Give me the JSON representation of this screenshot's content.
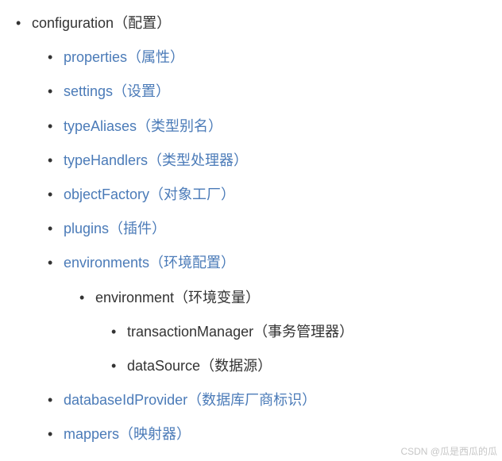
{
  "tree": {
    "root": {
      "label": "configuration（配置）",
      "children": [
        {
          "label": "properties（属性）",
          "link": true
        },
        {
          "label": "settings（设置）",
          "link": true
        },
        {
          "label": "typeAliases（类型别名）",
          "link": true
        },
        {
          "label": "typeHandlers（类型处理器）",
          "link": true
        },
        {
          "label": "objectFactory（对象工厂）",
          "link": true
        },
        {
          "label": "plugins（插件）",
          "link": true
        },
        {
          "label": "environments（环境配置）",
          "link": true,
          "children": [
            {
              "label": "environment（环境变量）",
              "link": false,
              "children": [
                {
                  "label": "transactionManager（事务管理器）",
                  "link": false
                },
                {
                  "label": "dataSource（数据源）",
                  "link": false
                }
              ]
            }
          ]
        },
        {
          "label": "databaseIdProvider（数据库厂商标识）",
          "link": true
        },
        {
          "label": "mappers（映射器）",
          "link": true
        }
      ]
    }
  },
  "watermark": "CSDN @瓜是西瓜的瓜"
}
